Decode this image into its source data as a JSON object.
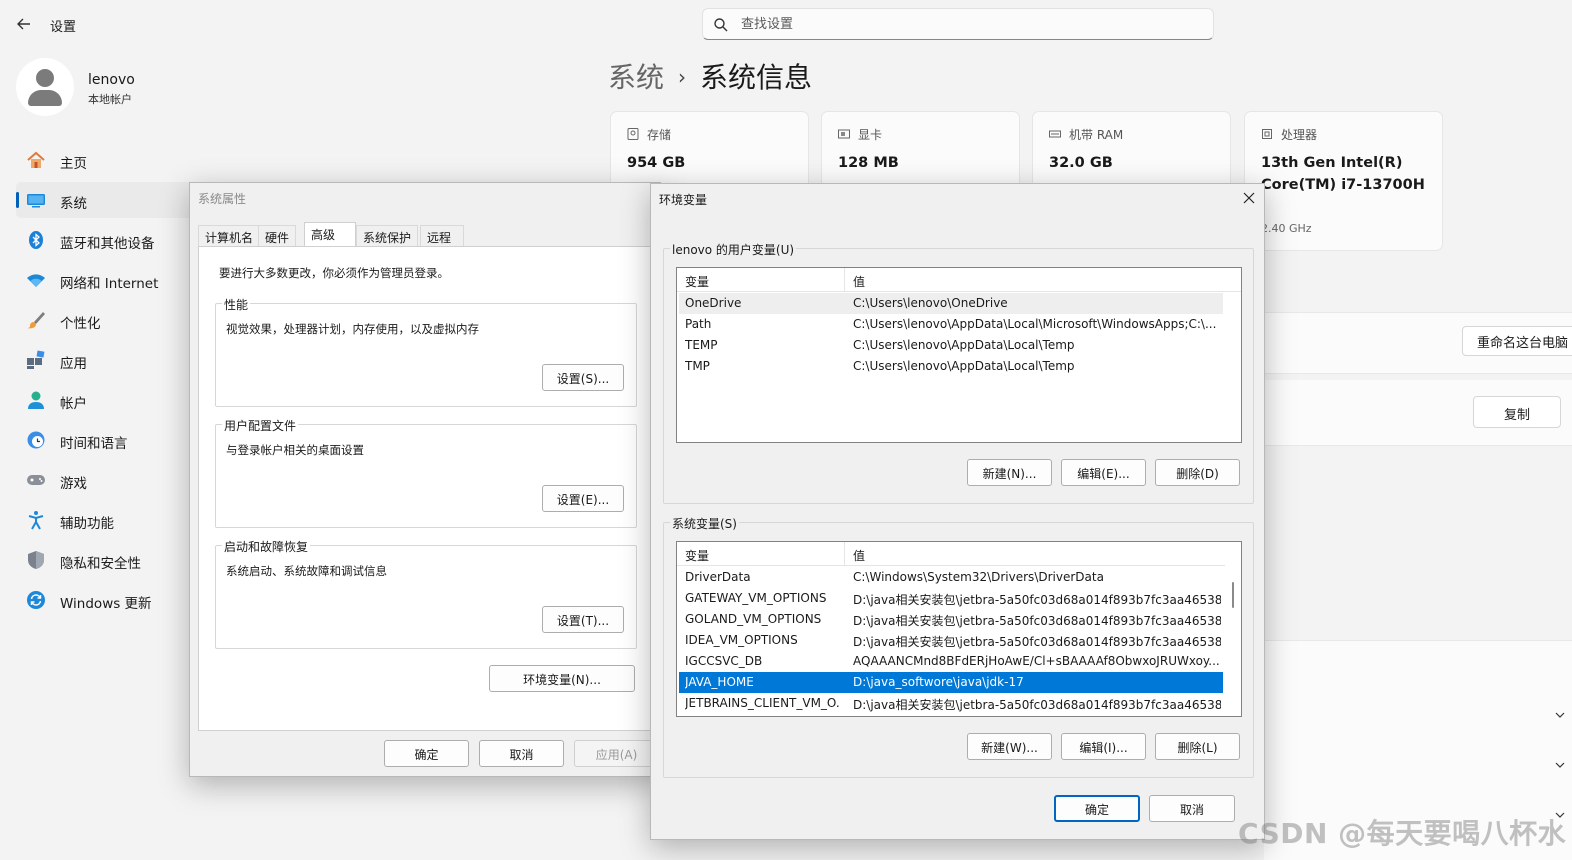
{
  "app": {
    "title": "设置"
  },
  "search": {
    "placeholder": "查找设置"
  },
  "user": {
    "name": "lenovo",
    "account_type": "本地帐户"
  },
  "nav": {
    "items": [
      {
        "label": "主页",
        "icon": "home-icon"
      },
      {
        "label": "系统",
        "icon": "system-icon",
        "active": true
      },
      {
        "label": "蓝牙和其他设备",
        "icon": "bluetooth-icon"
      },
      {
        "label": "网络和 Internet",
        "icon": "wifi-icon"
      },
      {
        "label": "个性化",
        "icon": "brush-icon"
      },
      {
        "label": "应用",
        "icon": "apps-icon"
      },
      {
        "label": "帐户",
        "icon": "account-icon"
      },
      {
        "label": "时间和语言",
        "icon": "clock-globe-icon"
      },
      {
        "label": "游戏",
        "icon": "gamepad-icon"
      },
      {
        "label": "辅助功能",
        "icon": "accessibility-icon"
      },
      {
        "label": "隐私和安全性",
        "icon": "shield-icon"
      },
      {
        "label": "Windows 更新",
        "icon": "update-icon"
      }
    ]
  },
  "breadcrumb": {
    "parent": "系统",
    "separator": "›",
    "current": "系统信息"
  },
  "specs": [
    {
      "label": "存储",
      "value": "954 GB",
      "icon": "storage-icon"
    },
    {
      "label": "显卡",
      "value": "128 MB",
      "icon": "gpu-icon"
    },
    {
      "label": "机带 RAM",
      "value": "32.0 GB",
      "icon": "ram-icon"
    },
    {
      "label": "处理器",
      "value": "13th Gen Intel(R) Core(TM) i7-13700H",
      "sub": "2.40 GHz",
      "icon": "cpu-icon"
    }
  ],
  "right_panel": {
    "rename_label": "重命名这台电脑",
    "copy_label": "复制"
  },
  "system_properties": {
    "title": "系统属性",
    "tabs": [
      "计算机名",
      "硬件",
      "高级",
      "系统保护",
      "远程"
    ],
    "active_tab": "高级",
    "admin_note": "要进行大多数更改，你必须作为管理员登录。",
    "performance": {
      "label": "性能",
      "desc": "视觉效果，处理器计划，内存使用，以及虚拟内存",
      "button": "设置(S)..."
    },
    "user_profiles": {
      "label": "用户配置文件",
      "desc": "与登录帐户相关的桌面设置",
      "button": "设置(E)..."
    },
    "startup_recovery": {
      "label": "启动和故障恢复",
      "desc": "系统启动、系统故障和调试信息",
      "button": "设置(T)..."
    },
    "env_button": "环境变量(N)...",
    "ok": "确定",
    "cancel": "取消",
    "apply": "应用(A)"
  },
  "env_vars": {
    "title": "环境变量",
    "user_group_label": "lenovo 的用户变量(U)",
    "col_var": "变量",
    "col_val": "值",
    "user_vars": [
      {
        "name": "OneDrive",
        "value": "C:\\Users\\lenovo\\OneDrive"
      },
      {
        "name": "Path",
        "value": "C:\\Users\\lenovo\\AppData\\Local\\Microsoft\\WindowsApps;C:\\..."
      },
      {
        "name": "TEMP",
        "value": "C:\\Users\\lenovo\\AppData\\Local\\Temp"
      },
      {
        "name": "TMP",
        "value": "C:\\Users\\lenovo\\AppData\\Local\\Temp"
      }
    ],
    "user_buttons": {
      "new": "新建(N)...",
      "edit": "编辑(E)...",
      "delete": "删除(D)"
    },
    "system_group_label": "系统变量(S)",
    "system_vars": [
      {
        "name": "DriverData",
        "value": "C:\\Windows\\System32\\Drivers\\DriverData"
      },
      {
        "name": "GATEWAY_VM_OPTIONS",
        "value": "D:\\java相关安装包\\jetbra-5a50fc03d68a014f893b7fc3aa46538..."
      },
      {
        "name": "GOLAND_VM_OPTIONS",
        "value": "D:\\java相关安装包\\jetbra-5a50fc03d68a014f893b7fc3aa46538..."
      },
      {
        "name": "IDEA_VM_OPTIONS",
        "value": "D:\\java相关安装包\\jetbra-5a50fc03d68a014f893b7fc3aa46538..."
      },
      {
        "name": "IGCCSVC_DB",
        "value": "AQAAANCMnd8BFdERjHoAwE/Cl+sBAAAAf8ObwxoJRUWxoy..."
      },
      {
        "name": "JAVA_HOME",
        "value": "D:\\java_softwore\\java\\jdk-17",
        "selected": true
      },
      {
        "name": "JETBRAINS_CLIENT_VM_O...",
        "value": "D:\\java相关安装包\\jetbra-5a50fc03d68a014f893b7fc3aa46538..."
      }
    ],
    "system_buttons": {
      "new": "新建(W)...",
      "edit": "编辑(I)...",
      "delete": "删除(L)"
    },
    "ok": "确定",
    "cancel": "取消"
  },
  "watermark": "CSDN @每天要喝八杯水",
  "colors": {
    "accent": "#005fb8",
    "selection": "#0078d7"
  }
}
